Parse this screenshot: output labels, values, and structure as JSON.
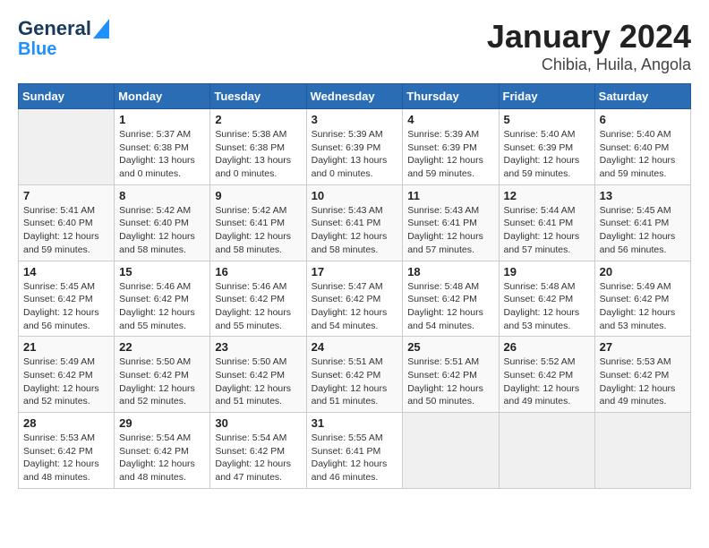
{
  "logo": {
    "line1": "General",
    "line2": "Blue"
  },
  "title": "January 2024",
  "subtitle": "Chibia, Huila, Angola",
  "weekdays": [
    "Sunday",
    "Monday",
    "Tuesday",
    "Wednesday",
    "Thursday",
    "Friday",
    "Saturday"
  ],
  "weeks": [
    [
      {
        "day": "",
        "info": ""
      },
      {
        "day": "1",
        "info": "Sunrise: 5:37 AM\nSunset: 6:38 PM\nDaylight: 13 hours\nand 0 minutes."
      },
      {
        "day": "2",
        "info": "Sunrise: 5:38 AM\nSunset: 6:38 PM\nDaylight: 13 hours\nand 0 minutes."
      },
      {
        "day": "3",
        "info": "Sunrise: 5:39 AM\nSunset: 6:39 PM\nDaylight: 13 hours\nand 0 minutes."
      },
      {
        "day": "4",
        "info": "Sunrise: 5:39 AM\nSunset: 6:39 PM\nDaylight: 12 hours\nand 59 minutes."
      },
      {
        "day": "5",
        "info": "Sunrise: 5:40 AM\nSunset: 6:39 PM\nDaylight: 12 hours\nand 59 minutes."
      },
      {
        "day": "6",
        "info": "Sunrise: 5:40 AM\nSunset: 6:40 PM\nDaylight: 12 hours\nand 59 minutes."
      }
    ],
    [
      {
        "day": "7",
        "info": "Sunrise: 5:41 AM\nSunset: 6:40 PM\nDaylight: 12 hours\nand 59 minutes."
      },
      {
        "day": "8",
        "info": "Sunrise: 5:42 AM\nSunset: 6:40 PM\nDaylight: 12 hours\nand 58 minutes."
      },
      {
        "day": "9",
        "info": "Sunrise: 5:42 AM\nSunset: 6:41 PM\nDaylight: 12 hours\nand 58 minutes."
      },
      {
        "day": "10",
        "info": "Sunrise: 5:43 AM\nSunset: 6:41 PM\nDaylight: 12 hours\nand 58 minutes."
      },
      {
        "day": "11",
        "info": "Sunrise: 5:43 AM\nSunset: 6:41 PM\nDaylight: 12 hours\nand 57 minutes."
      },
      {
        "day": "12",
        "info": "Sunrise: 5:44 AM\nSunset: 6:41 PM\nDaylight: 12 hours\nand 57 minutes."
      },
      {
        "day": "13",
        "info": "Sunrise: 5:45 AM\nSunset: 6:41 PM\nDaylight: 12 hours\nand 56 minutes."
      }
    ],
    [
      {
        "day": "14",
        "info": "Sunrise: 5:45 AM\nSunset: 6:42 PM\nDaylight: 12 hours\nand 56 minutes."
      },
      {
        "day": "15",
        "info": "Sunrise: 5:46 AM\nSunset: 6:42 PM\nDaylight: 12 hours\nand 55 minutes."
      },
      {
        "day": "16",
        "info": "Sunrise: 5:46 AM\nSunset: 6:42 PM\nDaylight: 12 hours\nand 55 minutes."
      },
      {
        "day": "17",
        "info": "Sunrise: 5:47 AM\nSunset: 6:42 PM\nDaylight: 12 hours\nand 54 minutes."
      },
      {
        "day": "18",
        "info": "Sunrise: 5:48 AM\nSunset: 6:42 PM\nDaylight: 12 hours\nand 54 minutes."
      },
      {
        "day": "19",
        "info": "Sunrise: 5:48 AM\nSunset: 6:42 PM\nDaylight: 12 hours\nand 53 minutes."
      },
      {
        "day": "20",
        "info": "Sunrise: 5:49 AM\nSunset: 6:42 PM\nDaylight: 12 hours\nand 53 minutes."
      }
    ],
    [
      {
        "day": "21",
        "info": "Sunrise: 5:49 AM\nSunset: 6:42 PM\nDaylight: 12 hours\nand 52 minutes."
      },
      {
        "day": "22",
        "info": "Sunrise: 5:50 AM\nSunset: 6:42 PM\nDaylight: 12 hours\nand 52 minutes."
      },
      {
        "day": "23",
        "info": "Sunrise: 5:50 AM\nSunset: 6:42 PM\nDaylight: 12 hours\nand 51 minutes."
      },
      {
        "day": "24",
        "info": "Sunrise: 5:51 AM\nSunset: 6:42 PM\nDaylight: 12 hours\nand 51 minutes."
      },
      {
        "day": "25",
        "info": "Sunrise: 5:51 AM\nSunset: 6:42 PM\nDaylight: 12 hours\nand 50 minutes."
      },
      {
        "day": "26",
        "info": "Sunrise: 5:52 AM\nSunset: 6:42 PM\nDaylight: 12 hours\nand 49 minutes."
      },
      {
        "day": "27",
        "info": "Sunrise: 5:53 AM\nSunset: 6:42 PM\nDaylight: 12 hours\nand 49 minutes."
      }
    ],
    [
      {
        "day": "28",
        "info": "Sunrise: 5:53 AM\nSunset: 6:42 PM\nDaylight: 12 hours\nand 48 minutes."
      },
      {
        "day": "29",
        "info": "Sunrise: 5:54 AM\nSunset: 6:42 PM\nDaylight: 12 hours\nand 48 minutes."
      },
      {
        "day": "30",
        "info": "Sunrise: 5:54 AM\nSunset: 6:42 PM\nDaylight: 12 hours\nand 47 minutes."
      },
      {
        "day": "31",
        "info": "Sunrise: 5:55 AM\nSunset: 6:41 PM\nDaylight: 12 hours\nand 46 minutes."
      },
      {
        "day": "",
        "info": ""
      },
      {
        "day": "",
        "info": ""
      },
      {
        "day": "",
        "info": ""
      }
    ]
  ]
}
